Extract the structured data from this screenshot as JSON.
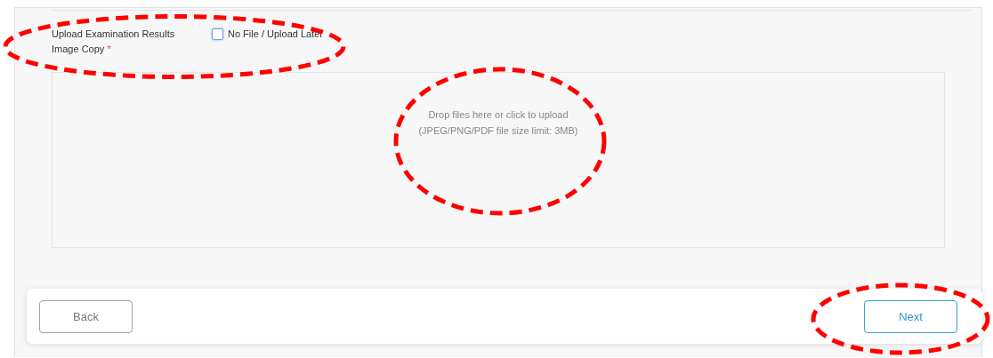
{
  "upload": {
    "label": "Upload Examination Results Image Copy",
    "required_mark": "*",
    "highlighted": true,
    "no_file_option": {
      "label": "No File / Upload Later",
      "checked": false
    }
  },
  "dropzone": {
    "lines": [
      "Drop files here or click to upload",
      "(JPEG/PNG/PDF file size limit: 3MB)"
    ],
    "highlighted": true
  },
  "footer": {
    "back": {
      "label": "Back",
      "highlighted": false
    },
    "next": {
      "label": "Next",
      "highlighted": true
    }
  }
}
